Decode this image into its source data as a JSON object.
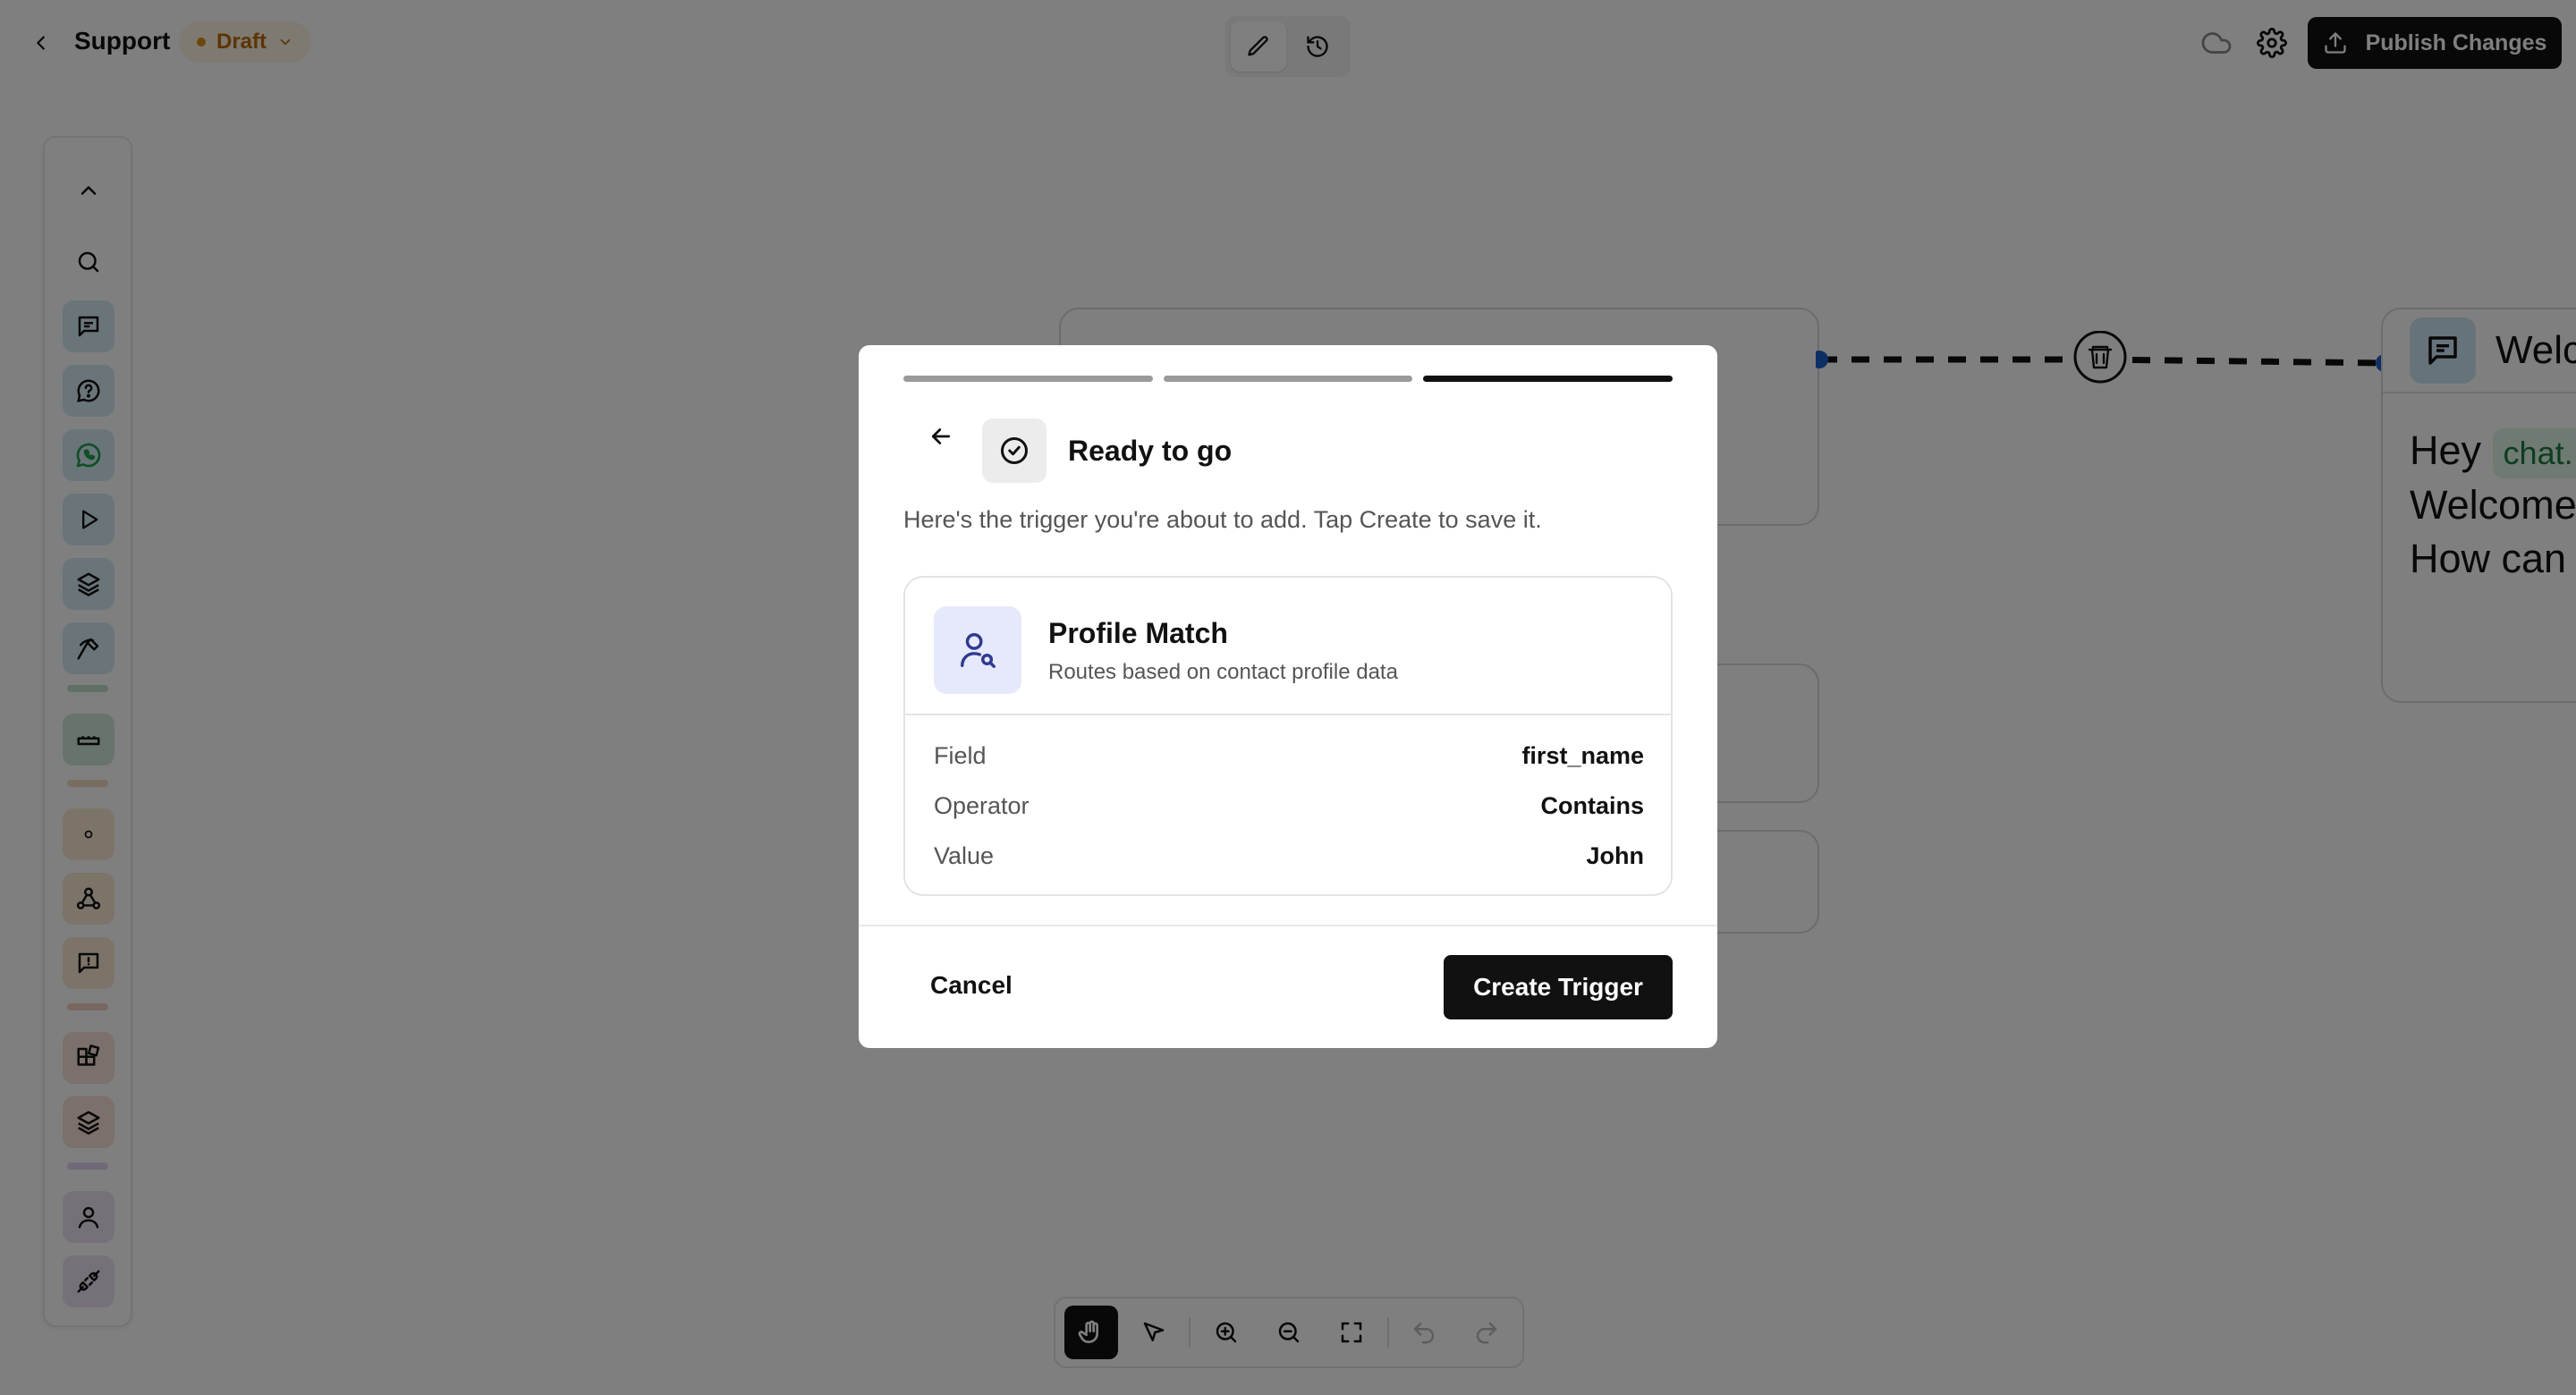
{
  "header": {
    "title": "Support",
    "status": "Draft",
    "publish_label": "Publish Changes"
  },
  "left_toolbar": {
    "icons": [
      "chevron-up",
      "search",
      "message",
      "help-circle",
      "whatsapp",
      "play",
      "layers",
      "axe",
      "ticket",
      "dot",
      "webhook",
      "message-square",
      "apps",
      "layers",
      "user",
      "plug"
    ]
  },
  "canvas": {
    "welcome_node": {
      "title": "Welc",
      "line1_text": "Hey",
      "line1_var": "chat.",
      "line2": "Welcome",
      "line3": "How can"
    }
  },
  "modal": {
    "progress_steps": 3,
    "current_step": 3,
    "title": "Ready to go",
    "description": "Here's the trigger you're about to add. Tap Create to save it.",
    "trigger": {
      "name": "Profile Match",
      "subtitle": "Routes based on contact profile data",
      "rows": [
        {
          "label": "Field",
          "value": "first_name"
        },
        {
          "label": "Operator",
          "value": "Contains"
        },
        {
          "label": "Value",
          "value": "John"
        }
      ]
    },
    "cancel_label": "Cancel",
    "create_label": "Create Trigger"
  },
  "colors": {
    "accent": "#111111",
    "draft": "#b86b08",
    "connector": "#1f5ec9",
    "trigger_icon_bg": "#e6e8fb",
    "trigger_icon": "#2f3a8f"
  }
}
